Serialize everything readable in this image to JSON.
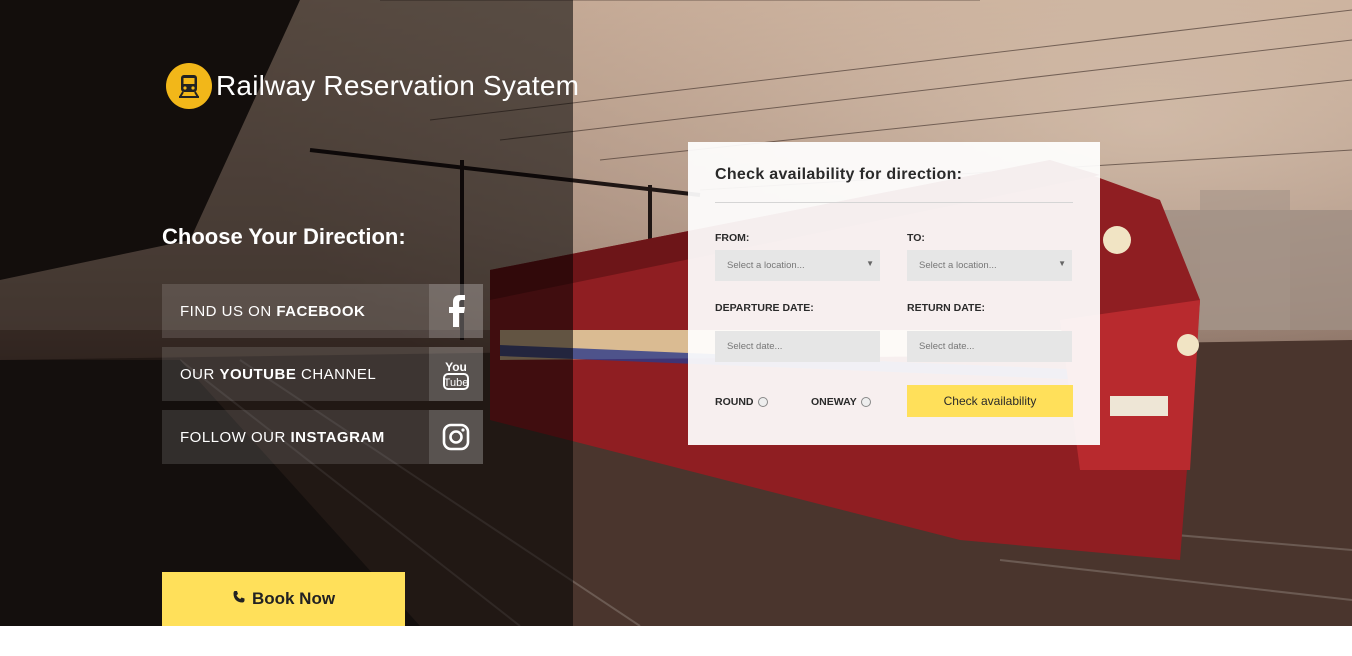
{
  "brand": {
    "title": "Railway Reservation Syatem",
    "logo_icon": "train-icon",
    "logo_color": "#f2b719"
  },
  "sidebar": {
    "heading": "Choose Your Direction:",
    "social": [
      {
        "prefix": "FIND US ON ",
        "bold": "FACEBOOK",
        "suffix": "",
        "icon": "facebook-icon"
      },
      {
        "prefix": "OUR ",
        "bold": "YOUTUBE",
        "suffix": " CHANNEL",
        "icon": "youtube-icon"
      },
      {
        "prefix": "FOLLOW OUR ",
        "bold": "INSTAGRAM",
        "suffix": "",
        "icon": "instagram-icon"
      }
    ],
    "book_label": "Book Now"
  },
  "form": {
    "title": "Check availability for direction:",
    "from_label": "FROM:",
    "to_label": "TO:",
    "from_placeholder": "Select a location...",
    "to_placeholder": "Select a location...",
    "departure_label": "DEPARTURE DATE:",
    "return_label": "RETURN DATE:",
    "date_placeholder": "Select date...",
    "round_label": "ROUND",
    "oneway_label": "ONEWAY",
    "submit_label": "Check availability"
  },
  "colors": {
    "accent": "#ffe05a",
    "panel": "#000000",
    "card": "#ffffff"
  }
}
